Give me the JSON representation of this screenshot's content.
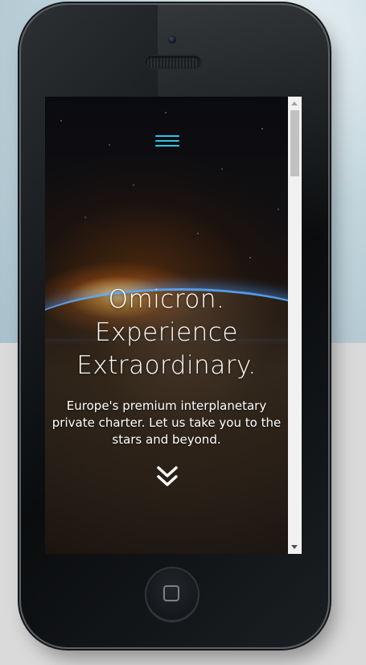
{
  "hero": {
    "title_line1": "Omicron.",
    "title_line2": "Experience",
    "title_line3": "Extraordinary.",
    "subtitle": "Europe's premium interplanetary private charter. Let us take you to the stars and beyond."
  },
  "icons": {
    "menu": "hamburger-menu-icon",
    "scroll": "double-chevron-down-icon",
    "home": "home-button-icon"
  },
  "colors": {
    "accent": "#2fc3ea",
    "text": "#ffffff"
  }
}
